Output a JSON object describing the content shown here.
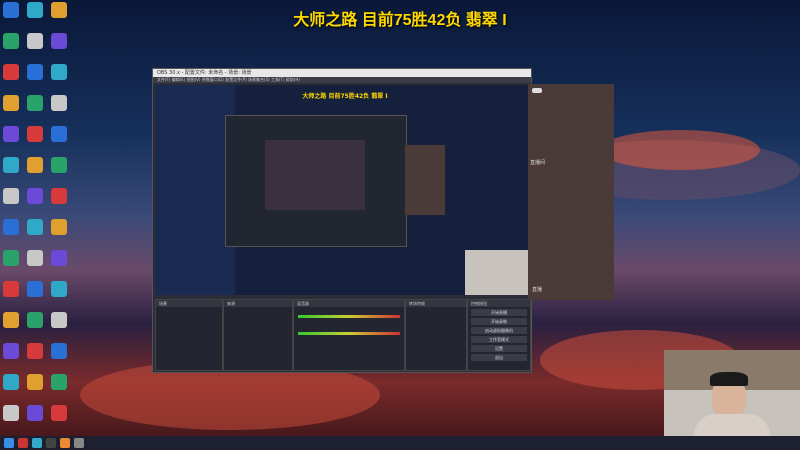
{
  "title": "大师之路 目前75胜42负 翡翠 I",
  "obs": {
    "window_title": "OBS 30.x - 配置文件: 未命名 - 场景: 场景",
    "menu": "文件(F) 编辑(E) 视图(V) 停靠窗口(D) 配置文件(P) 场景集合(S) 工具(T) 帮助(H)",
    "scenes_header": "场景",
    "sources_header": "来源",
    "mixer_header": "混音器",
    "transition_header": "转场特效",
    "controls_header": "控制按钮",
    "controls": [
      "开始直播",
      "开始录制",
      "启动虚拟摄像机",
      "工作室模式",
      "设置",
      "退出"
    ]
  },
  "chat": {
    "label": "直播间",
    "time": "直播"
  }
}
